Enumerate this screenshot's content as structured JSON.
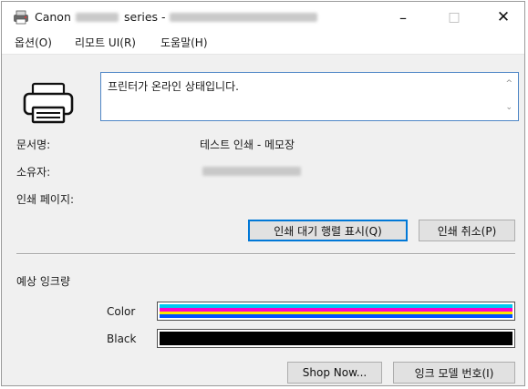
{
  "window": {
    "title_parts": [
      "Canon",
      "series -"
    ],
    "controls": {
      "minimize": "–",
      "maximize": "□",
      "close": "✕"
    }
  },
  "menu": [
    "옵션(O)",
    "리모트 UI(R)",
    "도움말(H)"
  ],
  "status": {
    "message": "프린터가 온라인 상태입니다.",
    "up_arrow": "^",
    "down_arrow": "⌄"
  },
  "fields": {
    "doc_name_label": "문서명:",
    "doc_name_value": "테스트 인쇄 - 메모장",
    "owner_label": "소유자:",
    "pages_label": "인쇄 페이지:"
  },
  "buttons": {
    "display_queue": "인쇄 대기 행렬 표시(Q)",
    "cancel_print": "인쇄 취소(P)",
    "shop_now": "Shop Now...",
    "ink_model": "잉크 모델 번호(I)"
  },
  "ink": {
    "section_label": "예상 잉크량",
    "color": {
      "label": "Color",
      "level": 1.0,
      "colors": [
        "#00c8f0",
        "#ff00c8",
        "#ffe600",
        "#0050ff"
      ]
    },
    "black": {
      "label": "Black",
      "level": 1.0,
      "color": "#000000"
    }
  }
}
